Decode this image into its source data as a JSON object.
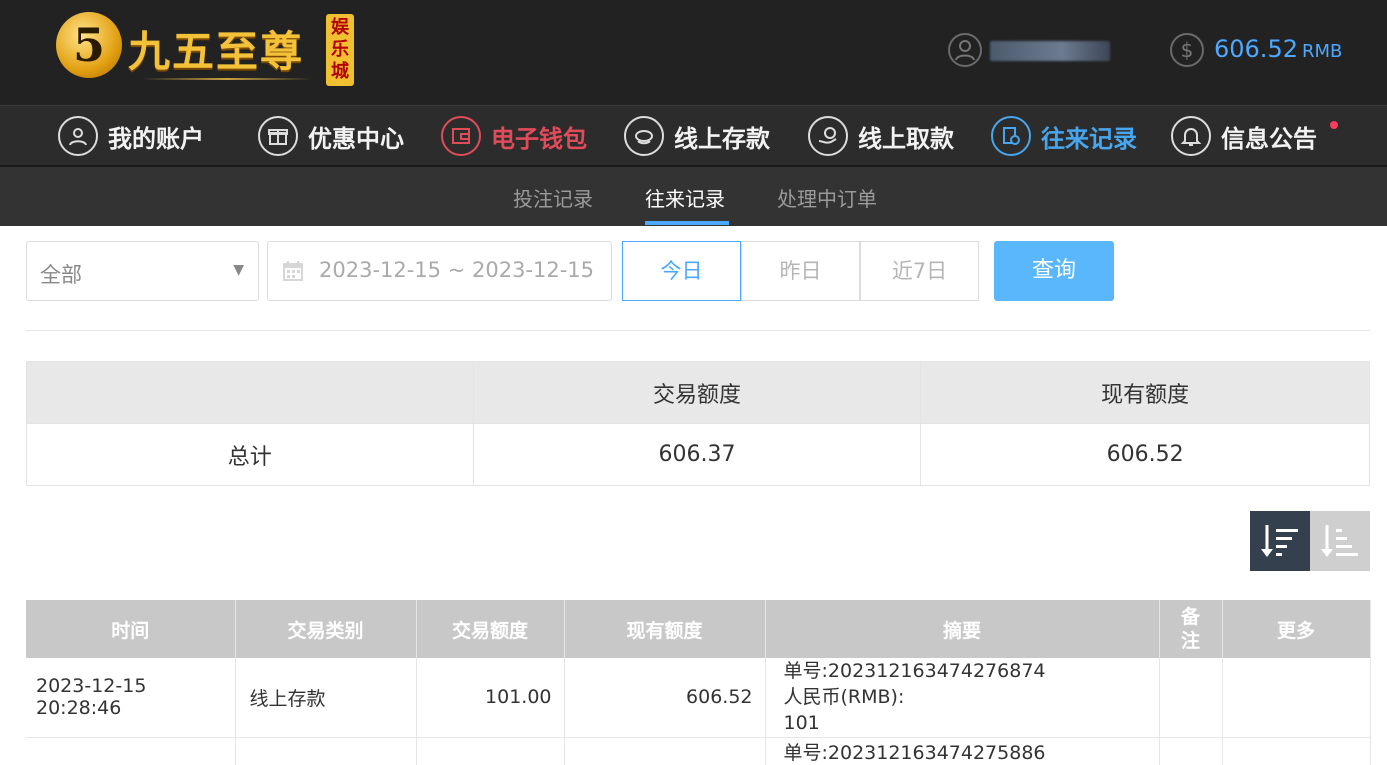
{
  "brand": {
    "logo_glyph": "5",
    "name": "九五至尊",
    "badge": "娱乐城"
  },
  "account": {
    "balance": "606.52",
    "currency": "RMB"
  },
  "main_nav": [
    {
      "label": "我的账户",
      "icon": "user-icon"
    },
    {
      "label": "优惠中心",
      "icon": "gift-icon"
    },
    {
      "label": "电子钱包",
      "icon": "wallet-icon"
    },
    {
      "label": "线上存款",
      "icon": "deposit-icon"
    },
    {
      "label": "线上取款",
      "icon": "withdraw-icon"
    },
    {
      "label": "往来记录",
      "icon": "records-icon"
    },
    {
      "label": "信息公告",
      "icon": "bell-icon"
    }
  ],
  "sub_nav": [
    {
      "label": "投注记录"
    },
    {
      "label": "往来记录"
    },
    {
      "label": "处理中订单"
    }
  ],
  "filters": {
    "type": "全部",
    "date_range": "2023-12-15 ~ 2023-12-15",
    "quick": [
      "今日",
      "昨日",
      "近7日"
    ],
    "query": "查询"
  },
  "summary": {
    "col_amount": "交易额度",
    "col_balance": "现有额度",
    "row_label": "总计",
    "amount": "606.37",
    "balance": "606.52"
  },
  "records": {
    "headers": [
      "时间",
      "交易类别",
      "交易额度",
      "现有额度",
      "摘要",
      "备注",
      "更多"
    ],
    "rows": [
      {
        "time": "2023-12-15 20:28:46",
        "type": "线上存款",
        "amount": "101.00",
        "balance": "606.52",
        "summary_line1": "单号:202312163474276874",
        "summary_line2": "人民币(RMB):",
        "summary_line3": "101",
        "note": "",
        "more": ""
      },
      {
        "summary_line1": "单号:202312163474275886"
      }
    ]
  },
  "colors": {
    "accent_blue": "#4da8ff",
    "accent_red": "#e14b5a",
    "query_button": "#5bb7fb"
  }
}
